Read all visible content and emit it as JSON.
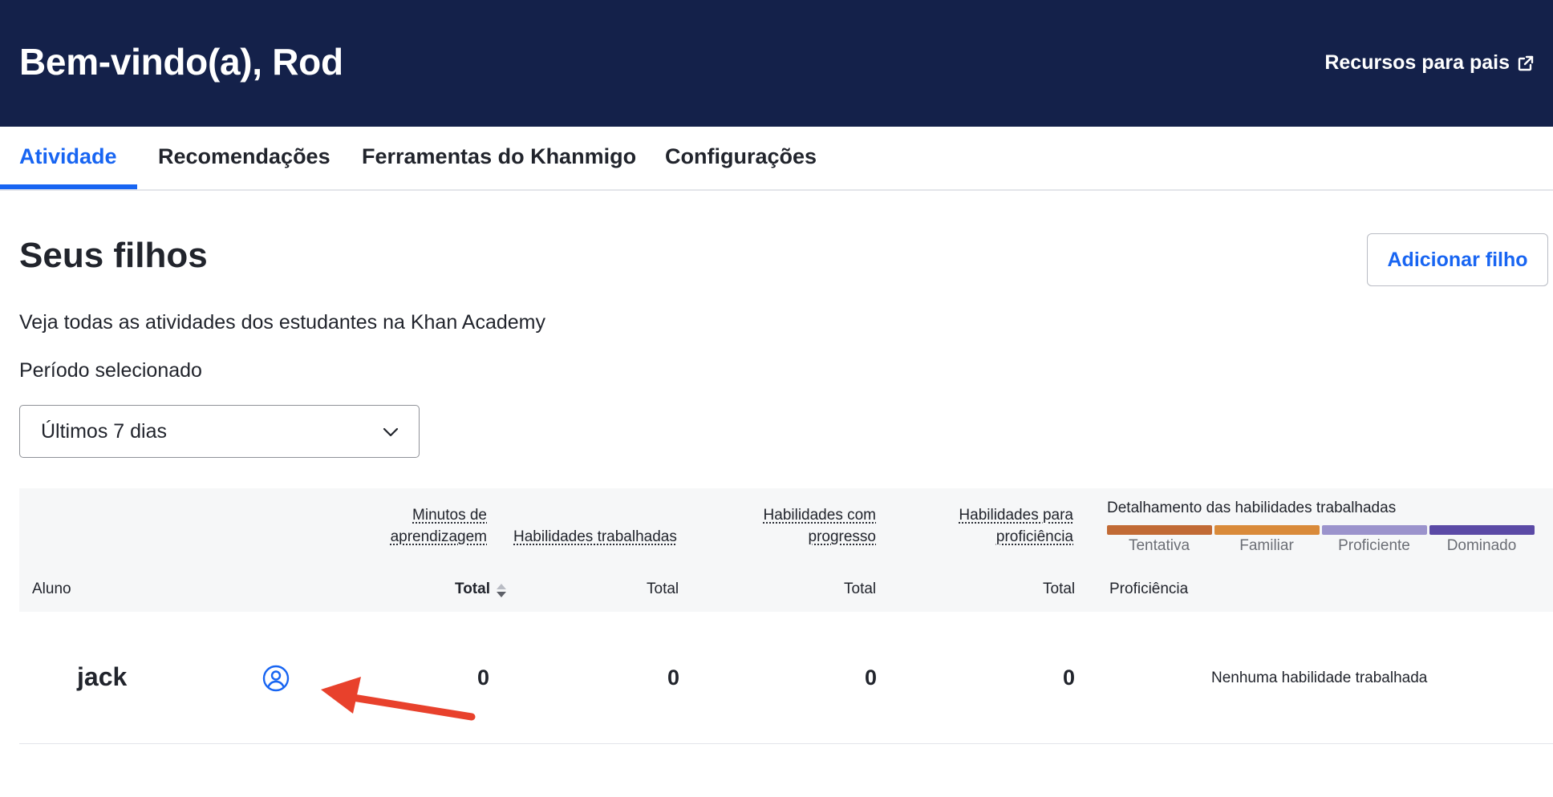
{
  "header": {
    "title": "Bem-vindo(a), Rod",
    "link_label": "Recursos para pais",
    "link_icon": "external-link-icon",
    "background": "#14214a"
  },
  "tabs": [
    {
      "label": "Atividade",
      "active": true
    },
    {
      "label": "Recomendações",
      "active": false
    },
    {
      "label": "Ferramentas do Khanmigo",
      "active": false
    },
    {
      "label": "Configurações",
      "active": false
    }
  ],
  "main": {
    "heading": "Seus filhos",
    "add_button": "Adicionar filho",
    "subtitle": "Veja todas as atividades dos estudantes na Khan Academy",
    "period_label": "Período selecionado",
    "period_value": "Últimos 7 dias"
  },
  "table": {
    "headers": {
      "minutes_line1": "Minutos de",
      "minutes_line2": "aprendizagem",
      "skills_worked": "Habilidades trabalhadas",
      "skills_progress_line1": "Habilidades com",
      "skills_progress_line2": "progresso",
      "skills_proficiency_line1": "Habilidades para",
      "skills_proficiency_line2": "proficiência",
      "breakdown": "Detalhamento das habilidades trabalhadas"
    },
    "breakdown_levels": [
      {
        "label": "Tentativa",
        "color": "#c16a35"
      },
      {
        "label": "Familiar",
        "color": "#d98a3a"
      },
      {
        "label": "Proficiente",
        "color": "#9b93cc"
      },
      {
        "label": "Dominado",
        "color": "#5b4aa6"
      }
    ],
    "subheaders": {
      "student": "Aluno",
      "total_sorted": "Total",
      "total": "Total",
      "proficiency": "Proficiência"
    },
    "rows": [
      {
        "name": "jack",
        "minutes": "0",
        "skills_worked": "0",
        "skills_progress": "0",
        "skills_proficiency": "0",
        "breakdown": "Nenhuma habilidade trabalhada"
      }
    ]
  },
  "annotation": {
    "arrow_color": "#e8412c"
  }
}
